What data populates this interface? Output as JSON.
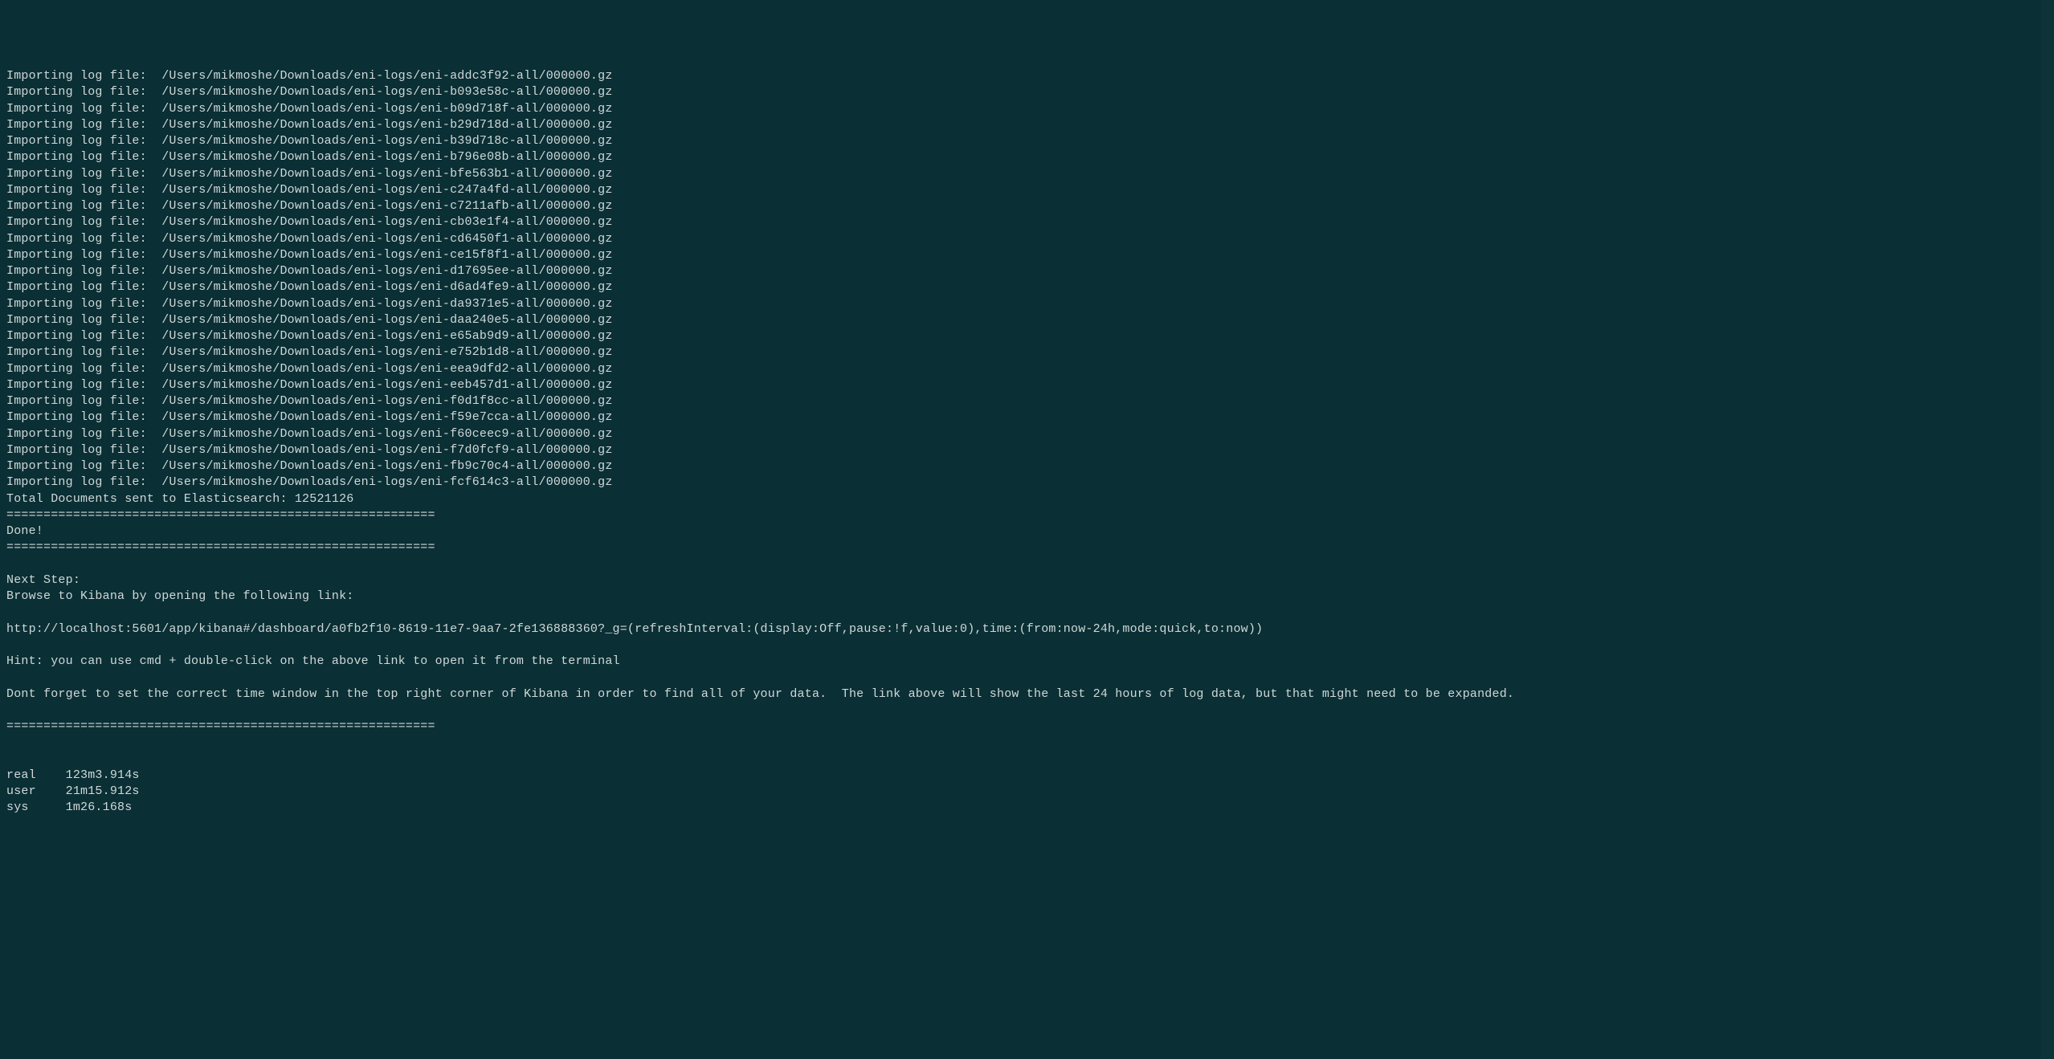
{
  "terminal": {
    "import_prefix": "Importing log file:  ",
    "log_base_path": "/Users/mikmoshe/Downloads/eni-logs/",
    "log_suffix": "-all/000000.gz",
    "log_ids": [
      "eni-addc3f92",
      "eni-b093e58c",
      "eni-b09d718f",
      "eni-b29d718d",
      "eni-b39d718c",
      "eni-b796e08b",
      "eni-bfe563b1",
      "eni-c247a4fd",
      "eni-c7211afb",
      "eni-cb03e1f4",
      "eni-cd6450f1",
      "eni-ce15f8f1",
      "eni-d17695ee",
      "eni-d6ad4fe9",
      "eni-da9371e5",
      "eni-daa240e5",
      "eni-e65ab9d9",
      "eni-e752b1d8",
      "eni-eea9dfd2",
      "eni-eeb457d1",
      "eni-f0d1f8cc",
      "eni-f59e7cca",
      "eni-f60ceec9",
      "eni-f7d0fcf9",
      "eni-fb9c70c4",
      "eni-fcf614c3"
    ],
    "total_docs_line": "Total Documents sent to Elasticsearch: 12521126",
    "separator": "==========================================================",
    "done_line": "Done!",
    "next_step_label": "Next Step:",
    "next_step_instruction": "Browse to Kibana by opening the following link:",
    "kibana_url": "http://localhost:5601/app/kibana#/dashboard/a0fb2f10-8619-11e7-9aa7-2fe136888360?_g=(refreshInterval:(display:Off,pause:!f,value:0),time:(from:now-24h,mode:quick,to:now))",
    "hint_line": "Hint: you can use cmd + double-click on the above link to open it from the terminal",
    "reminder_line": "Dont forget to set the correct time window in the top right corner of Kibana in order to find all of your data.  The link above will show the last 24 hours of log data, but that might need to be expanded.",
    "timing": {
      "real_label": "real",
      "real_value": "123m3.914s",
      "user_label": "user",
      "user_value": "21m15.912s",
      "sys_label": "sys",
      "sys_value": "1m26.168s"
    }
  }
}
